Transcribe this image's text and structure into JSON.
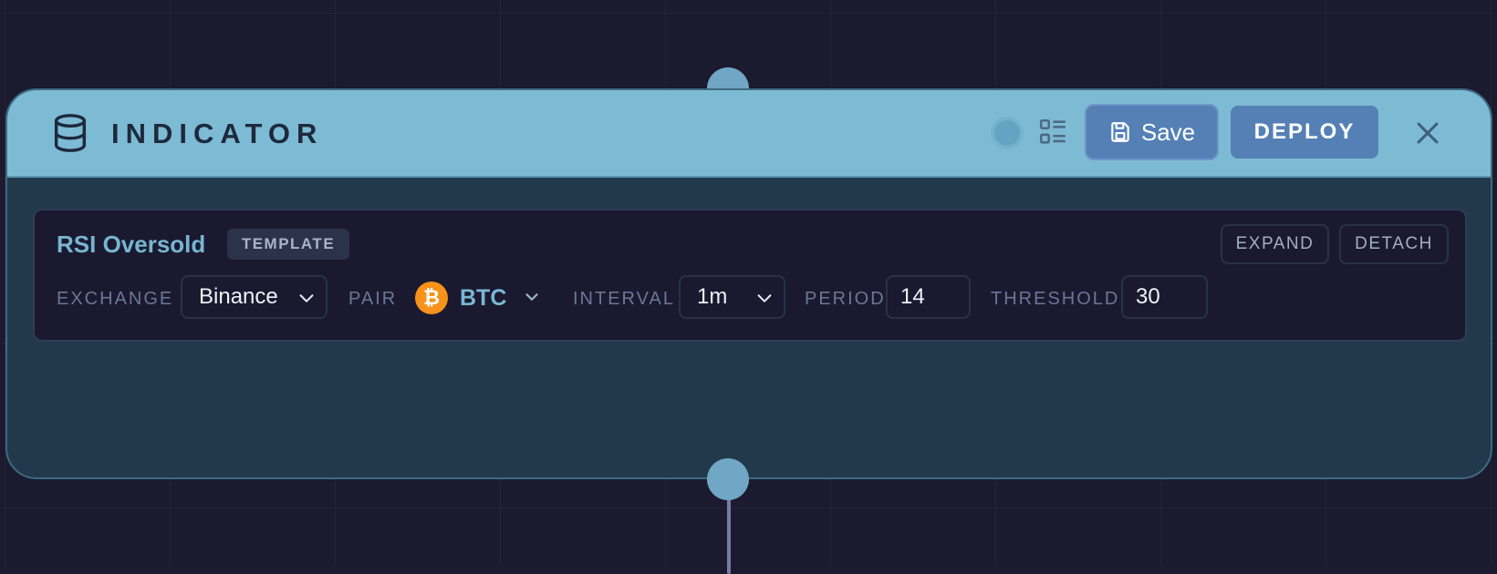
{
  "node": {
    "title": "INDICATOR",
    "icons": {
      "type_icon": "database-icon",
      "status": "status-dot-icon",
      "details": "list-details-icon",
      "close": "close-icon"
    },
    "save_label": "Save",
    "deploy_label": "DEPLOY"
  },
  "card": {
    "title": "RSI Oversold",
    "badge": "TEMPLATE",
    "expand_label": "EXPAND",
    "detach_label": "DETACH",
    "fields": {
      "exchange": {
        "label": "EXCHANGE",
        "value": "Binance"
      },
      "pair": {
        "label": "PAIR",
        "value": "BTC",
        "icon": "bitcoin-icon",
        "icon_glyph": "₿"
      },
      "interval": {
        "label": "INTERVAL",
        "value": "1m"
      },
      "period": {
        "label": "PERIOD",
        "value": "14"
      },
      "threshold": {
        "label": "THRESHOLD",
        "value": "30"
      }
    }
  },
  "colors": {
    "canvas": "#1b1a2e",
    "node_body": "#22394b",
    "node_header": "#7dbbd4",
    "accent_button": "#5480b6",
    "bitcoin": "#f7931a"
  }
}
